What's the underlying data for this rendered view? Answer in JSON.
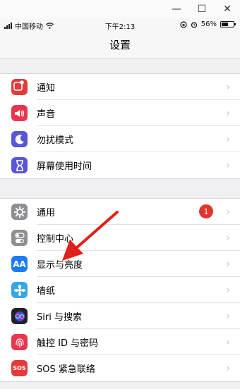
{
  "window": {
    "minimize": "—",
    "maximize": "☐",
    "close": "✕"
  },
  "status": {
    "carrier": "中国移动",
    "time": "下午2:13",
    "battery": "56%",
    "battery_level": 0.56
  },
  "nav": {
    "title": "设置"
  },
  "groups": [
    {
      "items": [
        {
          "label": "通知",
          "icon": "notifications-icon",
          "color": "#e33b3b"
        },
        {
          "label": "声音",
          "icon": "sound-icon",
          "color": "#e8364f"
        },
        {
          "label": "勿扰模式",
          "icon": "moon-icon",
          "color": "#5856d6"
        },
        {
          "label": "屏幕使用时间",
          "icon": "hourglass-icon",
          "color": "#5856d6"
        }
      ]
    },
    {
      "items": [
        {
          "label": "通用",
          "icon": "gear-icon",
          "color": "#8e8e93",
          "badge": "1"
        },
        {
          "label": "控制中心",
          "icon": "toggles-icon",
          "color": "#8e8e93"
        },
        {
          "label": "显示与亮度",
          "icon": "display-brightness-icon",
          "color": "#1c7cf2",
          "glyph": "AA"
        },
        {
          "label": "墙纸",
          "icon": "wallpaper-icon",
          "color": "#36a7e3"
        },
        {
          "label": "Siri 与搜索",
          "icon": "siri-icon",
          "color": "#222222"
        },
        {
          "label": "触控 ID 与密码",
          "icon": "fingerprint-icon",
          "color": "#e8364f"
        },
        {
          "label": "SOS 紧急联络",
          "icon": "sos-icon",
          "color": "#e33b3b",
          "glyph": "SOS"
        }
      ]
    }
  ],
  "colors": {
    "arrow": "#e0201a",
    "badge": "#e0362e",
    "background": "#efeff4"
  }
}
